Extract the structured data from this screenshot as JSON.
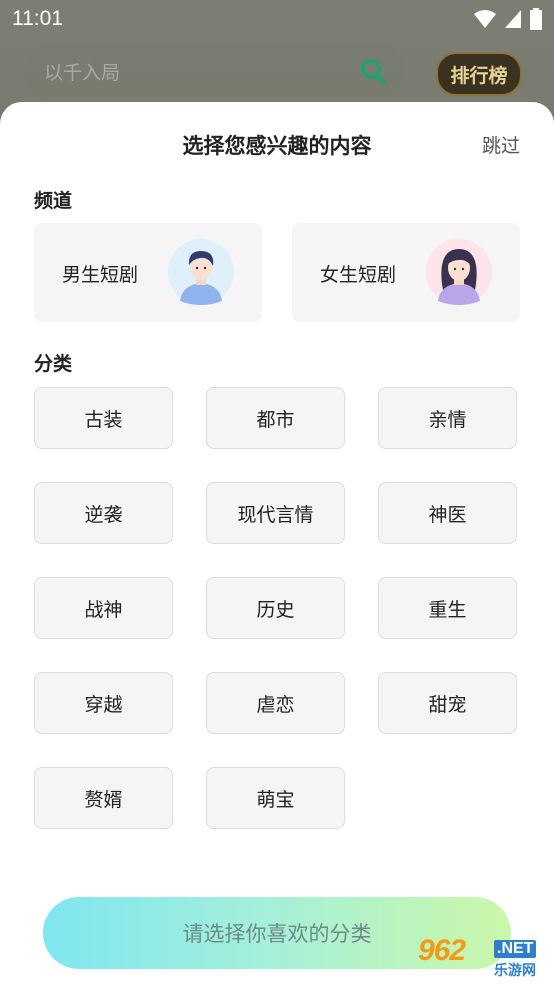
{
  "status_bar": {
    "time": "11:01"
  },
  "background_app": {
    "search_placeholder": "以千入局",
    "rank_badge_label": "排行榜"
  },
  "sheet": {
    "title": "选择您感兴趣的内容",
    "skip_label": "跳过",
    "channel_section_label": "频道",
    "channels": [
      {
        "label": "男生短剧",
        "avatar_icon": "male-avatar-icon"
      },
      {
        "label": "女生短剧",
        "avatar_icon": "female-avatar-icon"
      }
    ],
    "category_section_label": "分类",
    "categories": [
      "古装",
      "都市",
      "亲情",
      "逆袭",
      "现代言情",
      "神医",
      "战神",
      "历史",
      "重生",
      "穿越",
      "虐恋",
      "甜宠",
      "赘婿",
      "萌宝"
    ],
    "confirm_button_label": "请选择你喜欢的分类"
  },
  "watermark": {
    "main": "962",
    "suffix": ".NET",
    "site": "乐游网"
  },
  "colors": {
    "accent_gradient_start": "#7fe6f0",
    "accent_gradient_end": "#ccf7a8",
    "tag_background": "#f5f5f5",
    "tag_border": "#dcdcdc"
  }
}
